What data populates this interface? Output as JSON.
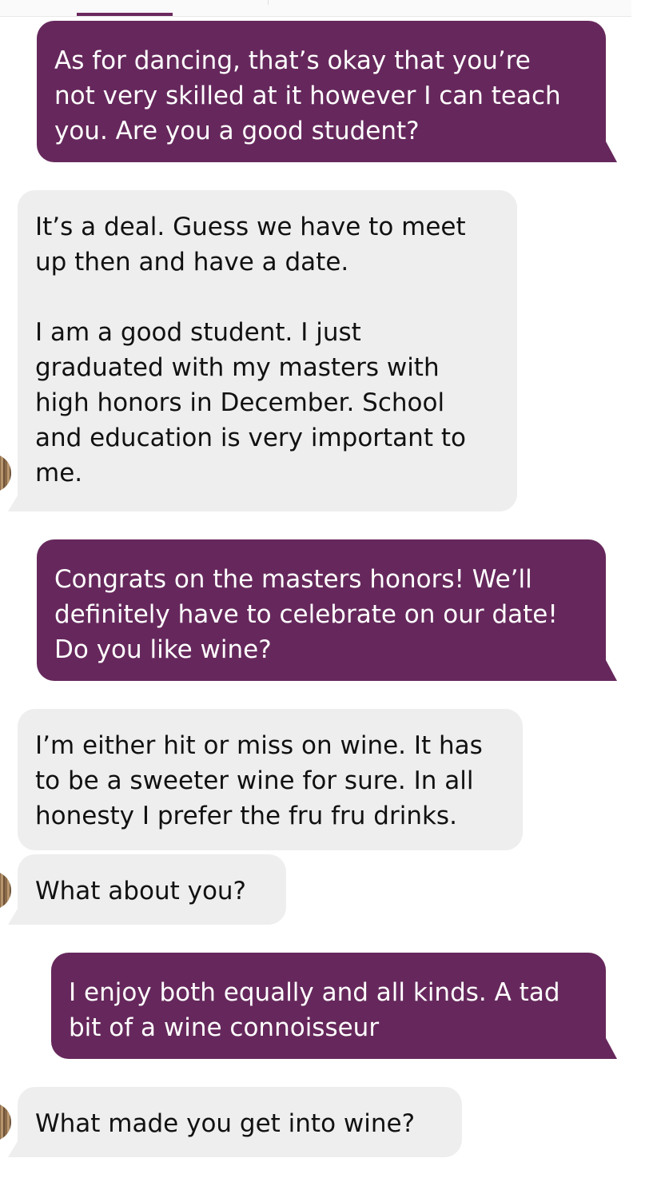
{
  "conversation": {
    "messages": [
      {
        "sender": "me",
        "text": "As for dancing, that’s okay that you’re\nnot very skilled at it however I can teach\nyou. Are you a good student?"
      },
      {
        "sender": "them",
        "text": "It’s a deal. Guess we have to meet\nup then and have a date.\n\nI am a good student. I just\ngraduated with my masters with\nhigh honors in December. School\nand education is very important to\nme."
      },
      {
        "sender": "me",
        "text": "Congrats on the masters honors! We’ll\ndefinitely have to celebrate on our date!\nDo you like wine?"
      },
      {
        "sender": "them",
        "text": "I’m either hit or miss on wine. It has\nto be a sweeter wine for sure. In all\nhonesty I prefer the fru fru drinks."
      },
      {
        "sender": "them",
        "text": "What about you?"
      },
      {
        "sender": "me",
        "text": "I enjoy both equally and all kinds. A tad\nbit of a wine connoisseur"
      },
      {
        "sender": "them",
        "text": "What made you get into wine?"
      }
    ]
  },
  "colors": {
    "outgoing_bubble": "#66285c",
    "incoming_bubble": "#eeeeee",
    "accent": "#6b2a5e"
  },
  "icons": {
    "avatar": "contact-avatar"
  }
}
